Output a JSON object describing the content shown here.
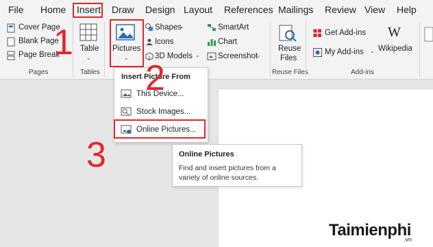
{
  "menu": {
    "items": [
      "File",
      "Home",
      "Insert",
      "Draw",
      "Design",
      "Layout",
      "References",
      "Mailings",
      "Review",
      "View",
      "Help"
    ]
  },
  "ribbon": {
    "pages": {
      "cover_page": "Cover Page",
      "blank_page": "Blank Page",
      "page_break": "Page Break",
      "group_label": "Pages"
    },
    "tables": {
      "table": "Table",
      "group_label": "Tables"
    },
    "illustrations": {
      "pictures": "Pictures",
      "shapes": "Shapes",
      "icons": "Icons",
      "models_3d": "3D Models",
      "smartart": "SmartArt",
      "chart": "Chart",
      "screenshot": "Screenshot"
    },
    "reuse": {
      "label_line1": "Reuse",
      "label_line2": "Files",
      "group_label": "Reuse Files"
    },
    "addins": {
      "get_addins": "Get Add-ins",
      "my_addins": "My Add-ins",
      "wikipedia": "Wikipedia",
      "group_label": "Add-ins",
      "wiki_glyph": "W"
    }
  },
  "dropdown": {
    "title": "Insert Picture From",
    "items": [
      "This Device...",
      "Stock Images...",
      "Online Pictures..."
    ]
  },
  "tooltip": {
    "title": "Online Pictures",
    "description": "Find and insert pictures from a variety of online sources."
  },
  "steps": [
    "1",
    "2",
    "3"
  ],
  "watermark": {
    "brand": "Taimienphi",
    "suffix": ".vn"
  },
  "colors": {
    "highlight": "#e3262b",
    "ribbon_bg": "#f3f3f3",
    "doc_bg": "#e6e6e6"
  }
}
